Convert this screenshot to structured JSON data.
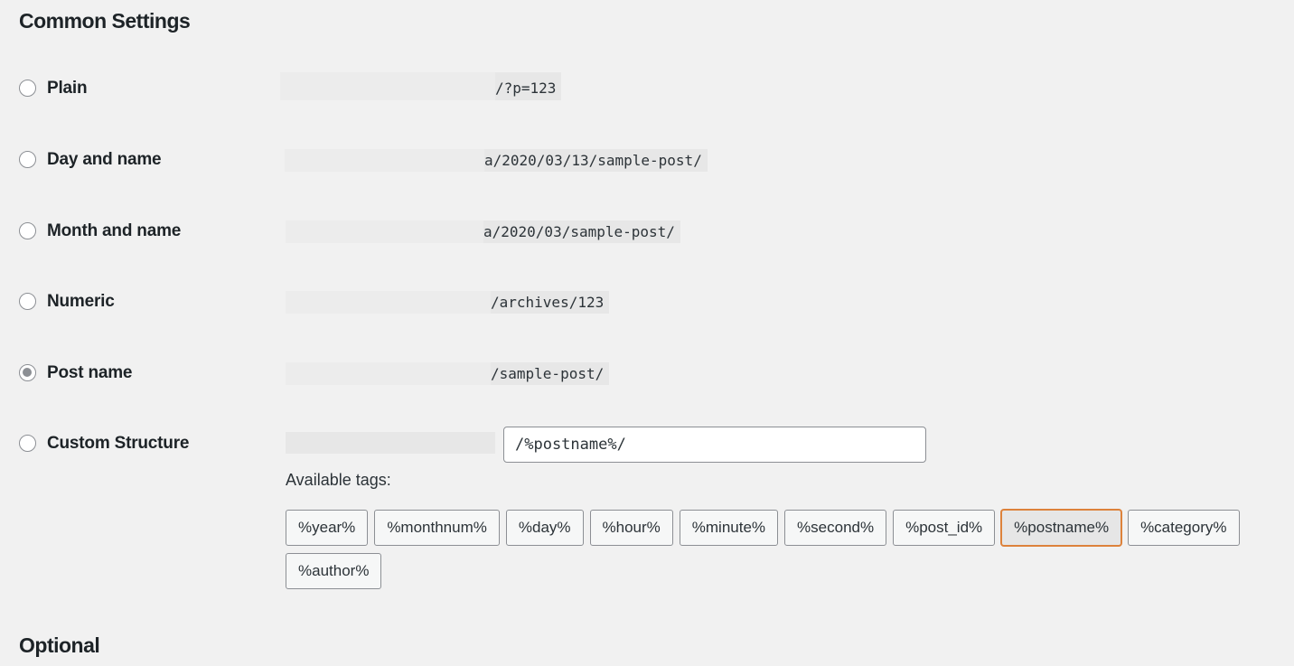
{
  "headings": {
    "common": "Common Settings",
    "optional": "Optional"
  },
  "options": [
    {
      "label": "Plain",
      "sample": "/?p=123",
      "checked": false
    },
    {
      "label": "Day and name",
      "sample": "a/2020/03/13/sample-post/",
      "checked": false
    },
    {
      "label": "Month and name",
      "sample": "a/2020/03/sample-post/",
      "checked": false
    },
    {
      "label": "Numeric",
      "sample": "/archives/123",
      "checked": false
    },
    {
      "label": "Post name",
      "sample": "/sample-post/",
      "checked": true
    },
    {
      "label": "Custom Structure",
      "checked": false
    }
  ],
  "custom_structure": {
    "value": "/%postname%/"
  },
  "available_tags": {
    "label": "Available tags:",
    "tags": [
      "%year%",
      "%monthnum%",
      "%day%",
      "%hour%",
      "%minute%",
      "%second%",
      "%post_id%",
      "%postname%",
      "%category%",
      "%author%"
    ],
    "active_tag": "%postname%"
  },
  "colors": {
    "active_tag_border": "#dd823b",
    "background": "#f1f1f1"
  }
}
